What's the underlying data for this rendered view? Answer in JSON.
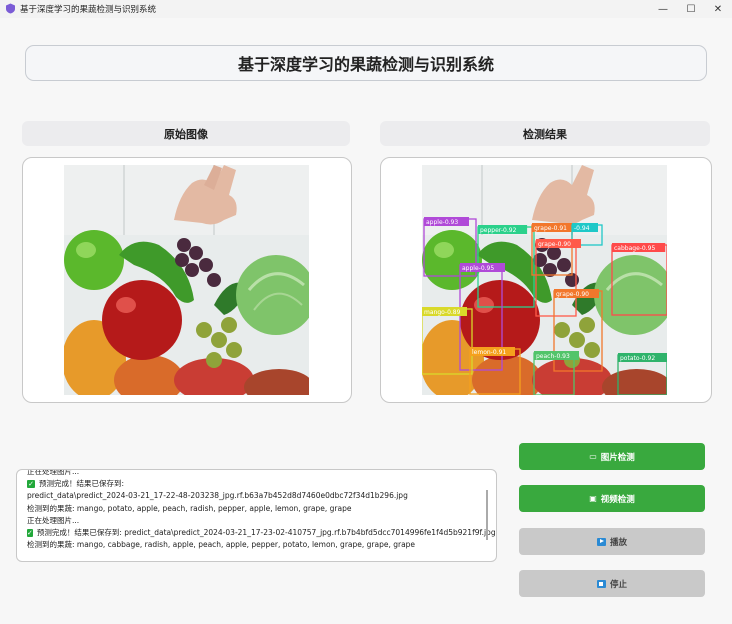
{
  "window": {
    "title": "基于深度学习的果蔬检测与识别系统",
    "min_glyph": "—",
    "max_glyph": "☐",
    "close_glyph": "✕"
  },
  "banner": {
    "title": "基于深度学习的果蔬检测与识别系统"
  },
  "left_panel": {
    "header": "原始图像"
  },
  "right_panel": {
    "header": "检测结果",
    "detections": [
      {
        "label": "apple",
        "score": "0.93",
        "color": "#b04ad8"
      },
      {
        "label": "pepper",
        "score": "0.92",
        "color": "#2bd18b"
      },
      {
        "label": "grape",
        "score": "0.91",
        "color": "#f2772c"
      },
      {
        "label": "",
        "score": "0.94",
        "color": "#1fc8c8"
      },
      {
        "label": "grape",
        "score": "0.90",
        "color": "#ff5a4a"
      },
      {
        "label": "cabbage",
        "score": "0.95",
        "color": "#ff4a4a"
      },
      {
        "label": "apple",
        "score": "0.95",
        "color": "#b04ad8"
      },
      {
        "label": "grape",
        "score": "0.90",
        "color": "#f2772c"
      },
      {
        "label": "mango",
        "score": "0.89",
        "color": "#d9d92a"
      },
      {
        "label": "lemon",
        "score": "0.91",
        "color": "#f5a11d"
      },
      {
        "label": "peach",
        "score": "0.93",
        "color": "#52c46a"
      },
      {
        "label": "potato",
        "score": "0.92",
        "color": "#2fb36b"
      }
    ]
  },
  "log": {
    "lines": [
      {
        "check": false,
        "text": "正在处理图片..."
      },
      {
        "check": true,
        "text": "预测完成！结果已保存到:"
      },
      {
        "check": false,
        "text": "predict_data\\predict_2024-03-21_17-22-48-203238_jpg.rf.b63a7b452d8d7460e0dbc72f34d1b296.jpg"
      },
      {
        "check": false,
        "text": "检测到的果蔬: mango, potato, apple, peach, radish, pepper, apple, lemon, grape, grape"
      },
      {
        "check": false,
        "text": "正在处理图片..."
      },
      {
        "check": true,
        "text": "预测完成！结果已保存到: predict_data\\predict_2024-03-21_17-23-02-410757_jpg.rf.b7b4bfd5dcc7014996fe1f4d5b921f9f.jpg"
      },
      {
        "check": false,
        "text": "检测到的果蔬: mango, cabbage, radish, apple, peach, apple, pepper, potato, lemon, grape, grape, grape"
      }
    ]
  },
  "buttons": {
    "image_detect": {
      "label": "图片检测",
      "icon": "image-icon"
    },
    "video_detect": {
      "label": "视频检测",
      "icon": "film-icon"
    },
    "play": {
      "label": "播放",
      "icon": "play-icon"
    },
    "stop": {
      "label": "停止",
      "icon": "stop-icon"
    }
  },
  "colors": {
    "green": "#39a93e",
    "disabled": "#c9c9c9",
    "accent_blue": "#2a8ad4"
  }
}
